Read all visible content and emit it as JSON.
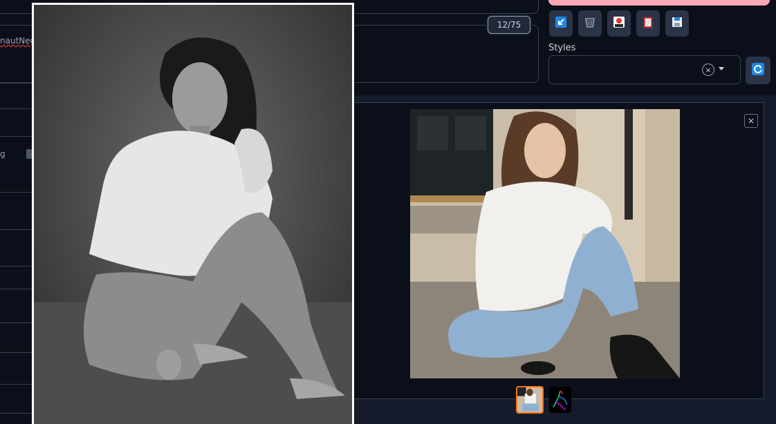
{
  "prompt": {
    "negative_text_fragment": "nautNeg",
    "token_counter": "12/75"
  },
  "toolbar": {
    "buttons": [
      {
        "name": "paste-button",
        "icon": "arrow-icon",
        "color": "#1e88e5"
      },
      {
        "name": "clear-button",
        "icon": "trash-icon",
        "color": "#9ca3af"
      },
      {
        "name": "extra-networks-button",
        "icon": "card-icon",
        "color": "#e53935"
      },
      {
        "name": "apply-style-button",
        "icon": "clipboard-icon",
        "color": "#e53935"
      },
      {
        "name": "save-style-button",
        "icon": "floppy-icon",
        "color": "#90a4ae"
      }
    ]
  },
  "styles": {
    "label": "Styles",
    "selected_value": "",
    "clear_symbol": "×",
    "refresh_icon": "refresh-icon"
  },
  "left_settings": {
    "row_char": "g"
  },
  "gallery": {
    "close_symbol": "×",
    "thumbnails": [
      {
        "name": "thumb-generated-image",
        "selected": true
      },
      {
        "name": "thumb-pose-skeleton",
        "selected": false
      }
    ]
  },
  "colors": {
    "background": "#0b0f19",
    "panel": "#151b2b",
    "accent_generate": "#f9a8b4",
    "selected_thumb": "#f97316"
  }
}
